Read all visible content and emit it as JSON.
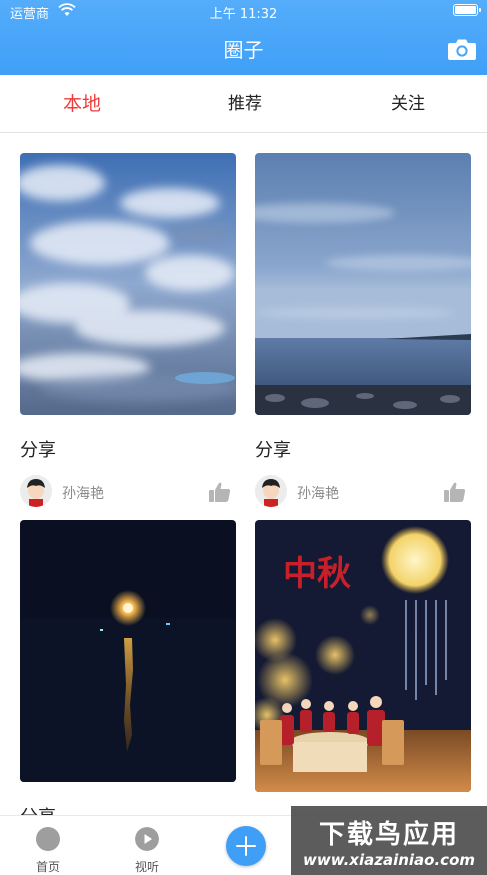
{
  "status_bar": {
    "carrier": "运营商",
    "time": "上午 11:32",
    "wifi_icon": "wifi-icon",
    "battery_icon": "battery-icon"
  },
  "header": {
    "title": "圈子",
    "camera_icon": "camera-icon",
    "background": "#4aa6f9"
  },
  "tabs": [
    {
      "label": "本地",
      "active": true
    },
    {
      "label": "推荐",
      "active": false
    },
    {
      "label": "关注",
      "active": false
    }
  ],
  "accent_color": "#ef3b3b",
  "posts": [
    {
      "title": "分享",
      "author": "孙海艳",
      "image": "cloudy-sky-photo"
    },
    {
      "title": "分享",
      "author": "孙海艳",
      "image": "seashore-dusk-photo"
    },
    {
      "title": "分享",
      "image": "moon-over-water-photo"
    },
    {
      "image": "mid-autumn-festival-poster",
      "poster_text": "中秋"
    }
  ],
  "tabbar": {
    "items": [
      {
        "label": "首页",
        "icon": "home-icon"
      },
      {
        "label": "视听",
        "icon": "play-icon"
      }
    ],
    "add_icon": "plus-icon"
  },
  "watermark": {
    "logo_text": "下载鸟应用",
    "url": "www.xiazainiao.com"
  }
}
